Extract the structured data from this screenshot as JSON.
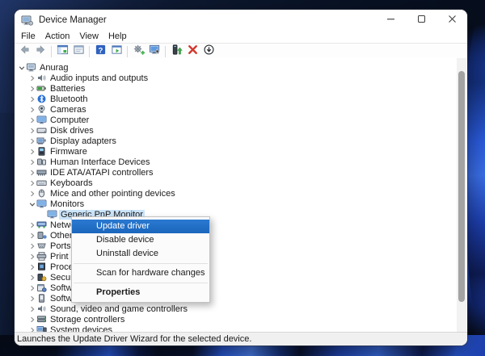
{
  "window": {
    "title": "Device Manager",
    "icon": "device-manager-icon",
    "controls": [
      {
        "name": "minimize-button",
        "icon": "minimize-icon"
      },
      {
        "name": "maximize-button",
        "icon": "maximize-icon"
      },
      {
        "name": "close-button",
        "icon": "close-icon"
      }
    ]
  },
  "menubar": {
    "items": [
      "File",
      "Action",
      "View",
      "Help"
    ]
  },
  "toolbar": {
    "items": [
      {
        "icon": "back-icon"
      },
      {
        "icon": "forward-icon"
      },
      {
        "separator": true
      },
      {
        "icon": "console-tree-icon"
      },
      {
        "icon": "properties-window-icon"
      },
      {
        "separator": true
      },
      {
        "icon": "help-icon"
      },
      {
        "icon": "show-window-icon"
      },
      {
        "separator": true
      },
      {
        "icon": "scan-hardware-icon"
      },
      {
        "icon": "remote-computer-icon"
      },
      {
        "separator": true
      },
      {
        "icon": "update-driver-icon"
      },
      {
        "icon": "uninstall-device-icon"
      },
      {
        "icon": "disable-device-icon"
      }
    ]
  },
  "tree": {
    "items": [
      {
        "label": "Anurag",
        "level": 0,
        "icon": "computer-icon",
        "chevron": "expanded"
      },
      {
        "label": "Audio inputs and outputs",
        "level": 1,
        "icon": "speaker-icon",
        "chevron": "collapsed"
      },
      {
        "label": "Batteries",
        "level": 1,
        "icon": "battery-icon",
        "chevron": "collapsed"
      },
      {
        "label": "Bluetooth",
        "level": 1,
        "icon": "bluetooth-icon",
        "chevron": "collapsed"
      },
      {
        "label": "Cameras",
        "level": 1,
        "icon": "camera-icon",
        "chevron": "collapsed"
      },
      {
        "label": "Computer",
        "level": 1,
        "icon": "monitor-icon",
        "chevron": "collapsed"
      },
      {
        "label": "Disk drives",
        "level": 1,
        "icon": "disk-icon",
        "chevron": "collapsed"
      },
      {
        "label": "Display adapters",
        "level": 1,
        "icon": "display-adapter-icon",
        "chevron": "collapsed"
      },
      {
        "label": "Firmware",
        "level": 1,
        "icon": "firmware-icon",
        "chevron": "collapsed"
      },
      {
        "label": "Human Interface Devices",
        "level": 1,
        "icon": "hid-icon",
        "chevron": "collapsed"
      },
      {
        "label": "IDE ATA/ATAPI controllers",
        "level": 1,
        "icon": "ide-icon",
        "chevron": "collapsed"
      },
      {
        "label": "Keyboards",
        "level": 1,
        "icon": "keyboard-icon",
        "chevron": "collapsed"
      },
      {
        "label": "Mice and other pointing devices",
        "level": 1,
        "icon": "mouse-icon",
        "chevron": "collapsed"
      },
      {
        "label": "Monitors",
        "level": 1,
        "icon": "monitor-icon",
        "chevron": "expanded"
      },
      {
        "label": "Generic PnP Monitor",
        "level": 2,
        "icon": "monitor-icon",
        "chevron": "none",
        "selected": true
      },
      {
        "label": "Network adapters",
        "level": 1,
        "icon": "network-icon",
        "chevron": "collapsed"
      },
      {
        "label": "Other devices",
        "level": 1,
        "icon": "other-device-icon",
        "chevron": "collapsed"
      },
      {
        "label": "Ports (COM & LPT)",
        "level": 1,
        "icon": "port-icon",
        "chevron": "collapsed"
      },
      {
        "label": "Print queues",
        "level": 1,
        "icon": "printer-icon",
        "chevron": "collapsed"
      },
      {
        "label": "Processors",
        "level": 1,
        "icon": "processor-icon",
        "chevron": "collapsed"
      },
      {
        "label": "Security devices",
        "level": 1,
        "icon": "security-icon",
        "chevron": "collapsed"
      },
      {
        "label": "Software components",
        "level": 1,
        "icon": "software-icon",
        "chevron": "collapsed"
      },
      {
        "label": "Software devices",
        "level": 1,
        "icon": "software-device-icon",
        "chevron": "collapsed"
      },
      {
        "label": "Sound, video and game controllers",
        "level": 1,
        "icon": "speaker-icon",
        "chevron": "collapsed"
      },
      {
        "label": "Storage controllers",
        "level": 1,
        "icon": "storage-icon",
        "chevron": "collapsed"
      },
      {
        "label": "System devices",
        "level": 1,
        "icon": "system-icon",
        "chevron": "collapsed"
      }
    ]
  },
  "context_menu": {
    "items": [
      {
        "label": "Update driver",
        "highlighted": true
      },
      {
        "label": "Disable device"
      },
      {
        "label": "Uninstall device"
      },
      {
        "separator": true
      },
      {
        "label": "Scan for hardware changes"
      },
      {
        "separator": true
      },
      {
        "label": "Properties",
        "bold": true
      }
    ]
  },
  "statusbar": {
    "text": "Launches the Update Driver Wizard for the selected device."
  },
  "colors": {
    "menu_highlight": "#1e6cc5",
    "tree_selection": "#cbe4f9",
    "statusbar_bg": "#f0f0f0",
    "wallpaper_base": "#0a1126",
    "wallpaper_ribbon": "#3a6fe8"
  }
}
